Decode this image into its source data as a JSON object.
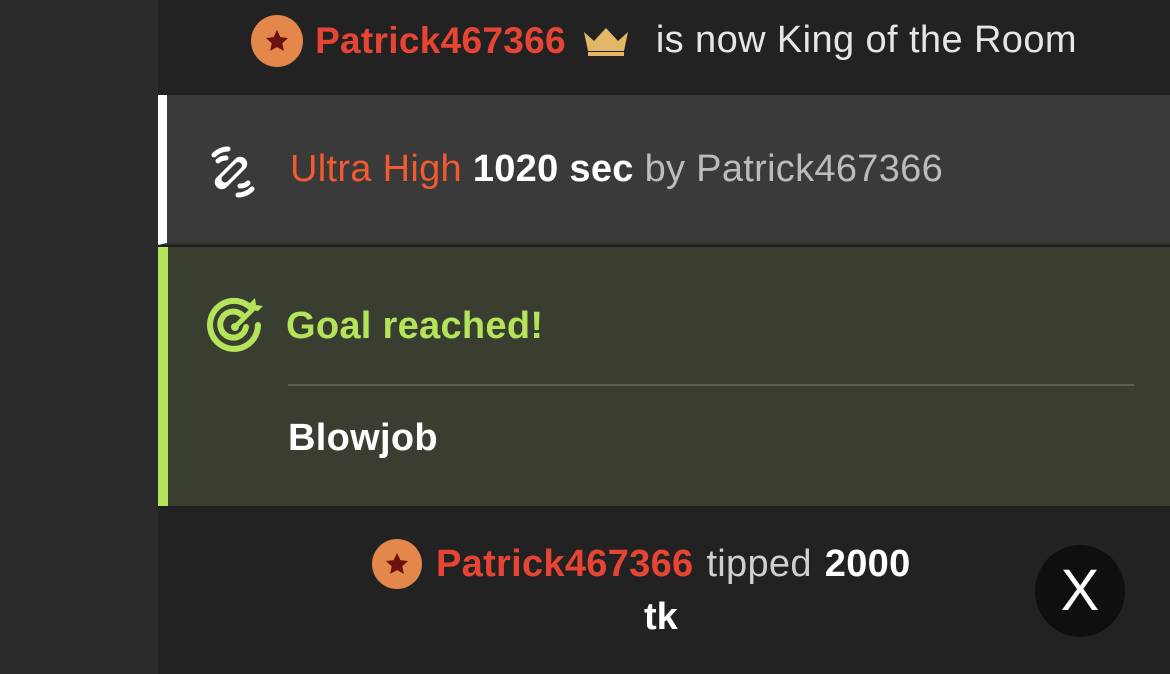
{
  "king_message": {
    "username": "Patrick467366",
    "text": "is now King of the Room",
    "badge_icon": "star-icon",
    "crown_icon": "crown-icon"
  },
  "vibe_message": {
    "icon": "vibration-icon",
    "level": "Ultra High",
    "duration": "1020 sec",
    "by": "by",
    "username": "Patrick467366"
  },
  "goal_message": {
    "icon": "target-icon",
    "title": "Goal reached!",
    "goal_name": "Blowjob"
  },
  "tip_message": {
    "username": "Patrick467366",
    "verb": "tipped",
    "amount": "2000",
    "unit": "tk",
    "badge_icon": "star-icon"
  },
  "close_button": {
    "label": "X",
    "icon": "close-icon"
  },
  "colors": {
    "username": "#e84434",
    "badge": "#e3874a",
    "crown": "#e2b866",
    "level": "#f25a30",
    "goal_accent": "#b3e45a"
  }
}
